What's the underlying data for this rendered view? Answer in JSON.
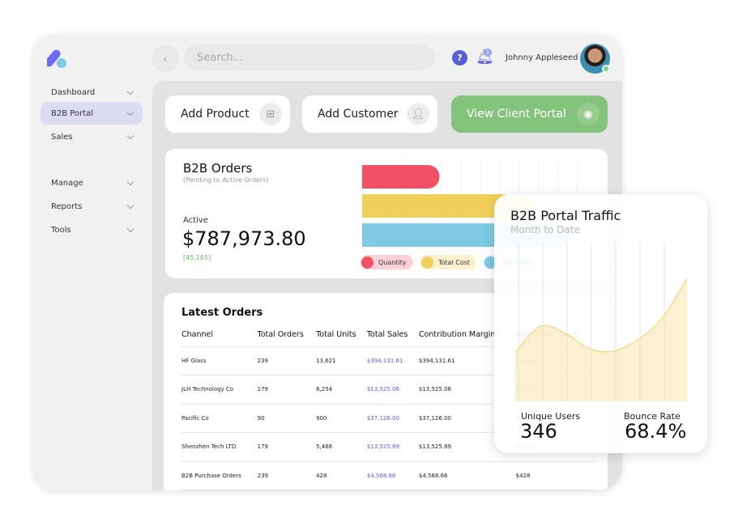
{
  "header": {
    "search_placeholder": "Search...",
    "user_name": "Johnny Appleseed",
    "notification_count": "1",
    "help": "?"
  },
  "sidebar": {
    "items": [
      {
        "label": "Dashboard"
      },
      {
        "label": "B2B Portal",
        "active": true
      },
      {
        "label": "Sales"
      },
      {
        "label": "Manage"
      },
      {
        "label": "Reports"
      },
      {
        "label": "Tools"
      }
    ]
  },
  "actions": [
    {
      "label": "Add Product",
      "icon": "file-plus-icon"
    },
    {
      "label": "Add Customer",
      "icon": "user-plus-icon"
    },
    {
      "label": "View Client Portal",
      "icon": "eye-icon"
    }
  ],
  "orders": {
    "title": "B2B Orders",
    "subtitle": "(Pending to Active Orders)",
    "active_label": "Active",
    "amount": "$787,973.80",
    "count": "[45,165]"
  },
  "chart_data": {
    "type": "bar",
    "orientation": "horizontal",
    "series": [
      {
        "name": "Quantity",
        "value": 37,
        "color": "#f25066"
      },
      {
        "name": "Total Cost",
        "value": 82,
        "color": "#f2cf5b"
      },
      {
        "name": "Total Paid",
        "value": 100,
        "color": "#7ec9e3"
      }
    ],
    "grid": true,
    "legend": "bottom"
  },
  "latest": {
    "title": "Latest Orders",
    "columns": [
      "Channel",
      "Total Orders",
      "Total Units",
      "Total Sales",
      "Contribution Margin",
      "Avg Order Value"
    ],
    "rows": [
      [
        "HF Glass",
        "239",
        "13,621",
        "$394,131.61",
        "$394,131.61",
        "$13,621"
      ],
      [
        "JLH Technology Co",
        "179",
        "6,254",
        "$13,525.06",
        "$13,525.06",
        "$6,254"
      ],
      [
        "Pacific Co",
        "90",
        "900",
        "$37,126.00",
        "$37,126.00",
        "$900"
      ],
      [
        "Shenzhen Tech LTD",
        "179",
        "5,468",
        "$13,525.89",
        "$13,525.89",
        "$5,468"
      ],
      [
        "B2B Purchase Orders",
        "239",
        "428",
        "$4,568.66",
        "$4,568.66",
        "$428"
      ]
    ]
  },
  "traffic": {
    "title": "B2B Portal Traffic",
    "subtitle": "Month to Date",
    "unique_label": "Unique Users",
    "unique_value": "346",
    "bounce_label": "Bounce Rate",
    "bounce_value": "68.4%",
    "chart_data": {
      "type": "area",
      "color": "#f2d77a",
      "y": [
        55,
        85,
        78,
        60,
        57,
        70,
        95,
        140
      ]
    }
  }
}
